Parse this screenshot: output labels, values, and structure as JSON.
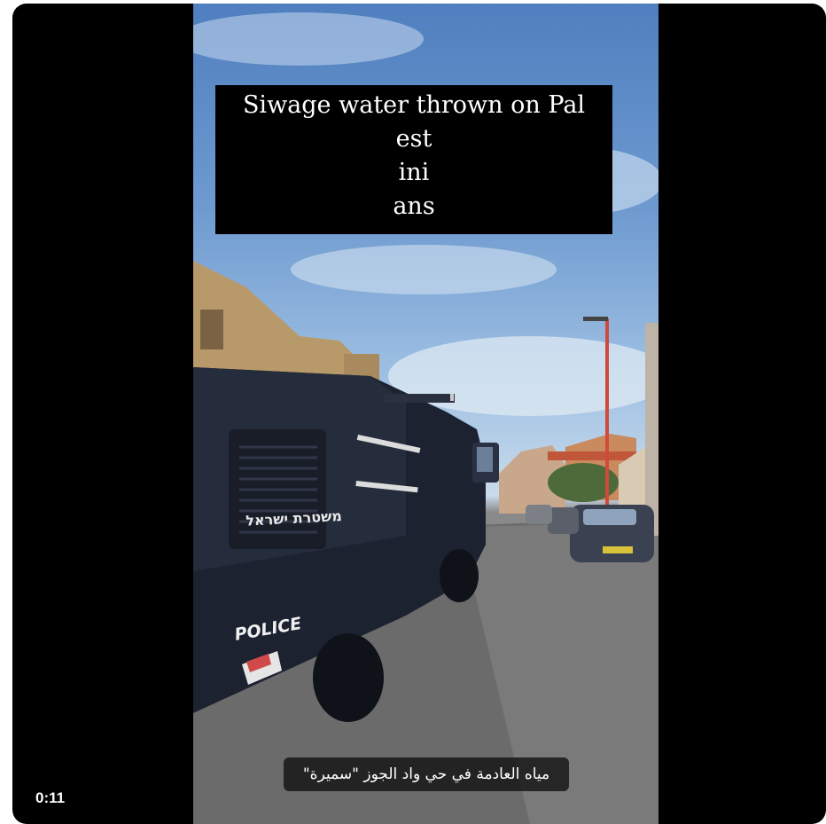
{
  "video": {
    "caption_lines": [
      "Siwage  water thrown on Pal",
      "est",
      "ini",
      "ans"
    ],
    "subtitle": "مياه العادمة في حي واد الجوز \"سميرة\"",
    "vehicle_label": "POLICE",
    "vehicle_hebrew": "משטרת ישראל",
    "elapsed_time": "0:11"
  }
}
